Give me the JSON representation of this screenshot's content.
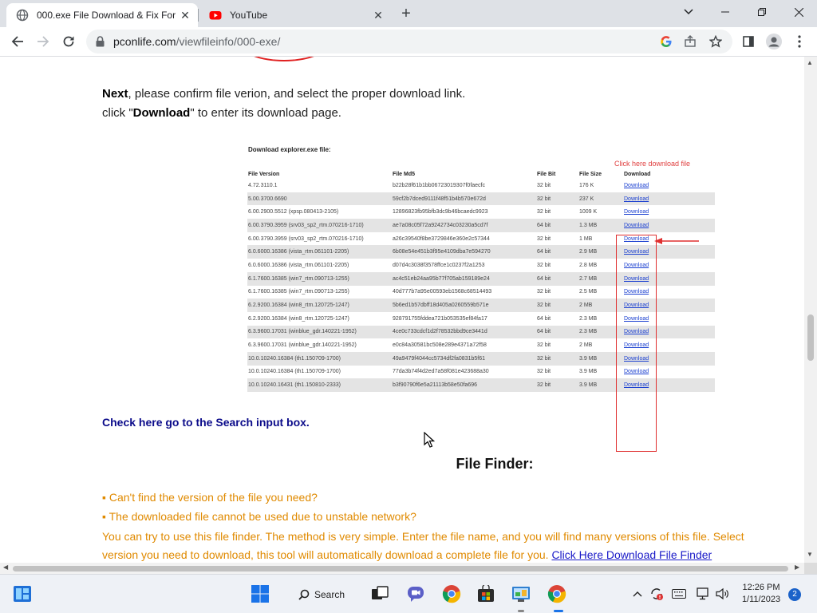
{
  "browser": {
    "tabs": [
      {
        "title": "000.exe File Download & Fix For",
        "favicon": "globe-icon",
        "active": true
      },
      {
        "title": "YouTube",
        "favicon": "youtube-icon",
        "active": false
      }
    ],
    "address": {
      "domain": "pconlife.com",
      "path": "/viewfileinfo/000-exe/"
    }
  },
  "page": {
    "next_bold": "Next",
    "next_text": ", please confirm file verion, and select the proper download link.",
    "click_prefix": "click \"",
    "click_bold": "Download",
    "click_suffix": "\" to enter its download page.",
    "screenshot": {
      "heading": "Download explorer.exe file:",
      "hint": "Click here download file",
      "columns": [
        "File Version",
        "File Md5",
        "File Bit",
        "File Size",
        "Download"
      ],
      "rows": [
        {
          "version": "4.72.3110.1",
          "md5": "b22b28f61b1bb06723019307f0faecfc",
          "bit": "32 bit",
          "size": "176 K",
          "link": "Download"
        },
        {
          "version": "5.00.3700.6690",
          "md5": "59cf2b7dced9111f48f51b4b570e672d",
          "bit": "32 bit",
          "size": "237 K",
          "link": "Download"
        },
        {
          "version": "6.00.2900.5512 (xpsp.080413-2105)",
          "md5": "12896823fb95bfb3dc9b46bcaedc9923",
          "bit": "32 bit",
          "size": "1009 K",
          "link": "Download"
        },
        {
          "version": "6.00.3790.3959 (srv03_sp2_rtm.070216-1710)",
          "md5": "ae7a08c05f72a9242734c03230a5cd7f",
          "bit": "64 bit",
          "size": "1.3 MB",
          "link": "Download"
        },
        {
          "version": "6.00.3790.3959 (srv03_sp2_rtm.070216-1710)",
          "md5": "a26c39540f8be3729846e360e2c57344",
          "bit": "32 bit",
          "size": "1 MB",
          "link": "Download"
        },
        {
          "version": "6.0.6000.16386 (vista_rtm.061101-2205)",
          "md5": "6b08e54e451b3f95e4109dba7e594270",
          "bit": "64 bit",
          "size": "2.9 MB",
          "link": "Download"
        },
        {
          "version": "6.0.6000.16386 (vista_rtm.061101-2205)",
          "md5": "d07d4c3038f3578ffce1c0237f2a1253",
          "bit": "32 bit",
          "size": "2.8 MB",
          "link": "Download"
        },
        {
          "version": "6.1.7600.16385 (win7_rtm.090713-1255)",
          "md5": "ac4c51eb24aa95b77f705ab159189e24",
          "bit": "64 bit",
          "size": "2.7 MB",
          "link": "Download"
        },
        {
          "version": "6.1.7600.16385 (win7_rtm.090713-1255)",
          "md5": "40d777b7a95e00593eb1568c68514493",
          "bit": "32 bit",
          "size": "2.5 MB",
          "link": "Download"
        },
        {
          "version": "6.2.9200.16384 (win8_rtm.120725-1247)",
          "md5": "5b6ed1b57dbff18d405a0260559b571e",
          "bit": "32 bit",
          "size": "2 MB",
          "link": "Download"
        },
        {
          "version": "6.2.9200.16384 (win8_rtm.120725-1247)",
          "md5": "928791755fddea721b053535ef84fa17",
          "bit": "64 bit",
          "size": "2.3 MB",
          "link": "Download"
        },
        {
          "version": "6.3.9600.17031 (winblue_gdr.140221-1952)",
          "md5": "4ce0c733cdcf1d2f78532bbd9ce3441d",
          "bit": "64 bit",
          "size": "2.3 MB",
          "link": "Download"
        },
        {
          "version": "6.3.9600.17031 (winblue_gdr.140221-1952)",
          "md5": "e0c84a30581bc508e289e4371a72f58",
          "bit": "32 bit",
          "size": "2 MB",
          "link": "Download"
        },
        {
          "version": "10.0.10240.16384 (th1.150709-1700)",
          "md5": "49a9479f4044cc5734df2fa0831b5f61",
          "bit": "32 bit",
          "size": "3.9 MB",
          "link": "Download"
        },
        {
          "version": "10.0.10240.16384 (th1.150709-1700)",
          "md5": "77da3b74f4d2ed7a58f081e423688a30",
          "bit": "32 bit",
          "size": "3.9 MB",
          "link": "Download"
        },
        {
          "version": "10.0.10240.16431 (th1.150810-2333)",
          "md5": "b3f90790f6e5a21113b58e50fa696",
          "bit": "32 bit",
          "size": "3.9 MB",
          "link": "Download"
        }
      ]
    },
    "search_link": "Check here go to the Search input box.",
    "finder_title": "File Finder:",
    "bullet1": "▪ Can't find the version of the file you need?",
    "bullet2": "▪ The downloaded file cannot be used due to unstable network?",
    "line3": "You can try to use this file finder. The method is very simple. Enter the file name, and you will find many versions of this file. Select",
    "line4": "version you need to download, this tool will automatically download a complete file for you.",
    "line4_link": "Click Here Download File Finder"
  },
  "taskbar": {
    "search_label": "Search",
    "time": "12:26 PM",
    "date": "1/11/2023",
    "notification_count": "2"
  }
}
